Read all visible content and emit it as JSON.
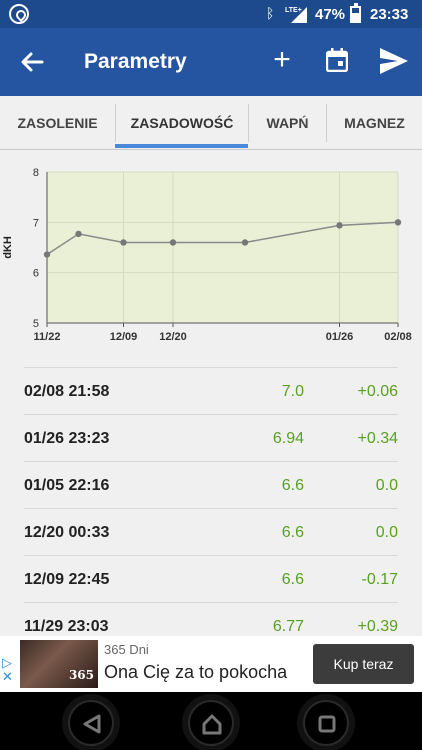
{
  "status_bar": {
    "battery": "47%",
    "time": "23:33",
    "network": "LTE+",
    "icons": [
      "app-notification-icon",
      "bluetooth-icon",
      "signal-icon",
      "battery-icon"
    ]
  },
  "app_bar": {
    "title": "Parametry",
    "icons": [
      "back-arrow-icon",
      "plus-icon",
      "calendar-icon",
      "send-icon"
    ]
  },
  "tabs": [
    {
      "label": "ZASOLENIE",
      "selected": false
    },
    {
      "label": "ZASADOWOŚĆ",
      "selected": true
    },
    {
      "label": "WAPŃ",
      "selected": false
    },
    {
      "label": "MAGNEZ",
      "selected": false
    }
  ],
  "colors": {
    "status_bar": "#1c4a8c",
    "app_bar": "#2555a0",
    "tab_indicator": "#4a88d9",
    "chart_fill": "#e9f0d6",
    "value_green": "#5aa020",
    "cta": "#3c3c3c"
  },
  "chart_data": {
    "type": "line",
    "ylabel": "dKH",
    "ylim": [
      5,
      8
    ],
    "y_ticks": [
      "5",
      "6",
      "7",
      "8"
    ],
    "x_tick_labels": [
      "11/22",
      "12/09",
      "12/20",
      "01/26",
      "02/08"
    ],
    "points": [
      {
        "date": "11/22",
        "y": 6.36
      },
      {
        "date": "11/29",
        "y": 6.77
      },
      {
        "date": "12/09",
        "y": 6.6
      },
      {
        "date": "12/20",
        "y": 6.6
      },
      {
        "date": "01/05",
        "y": 6.6
      },
      {
        "date": "01/26",
        "y": 6.94
      },
      {
        "date": "02/08",
        "y": 7.0
      }
    ]
  },
  "measurements": [
    {
      "date": "02/08 21:58",
      "value": "7.0",
      "delta": "+0.06"
    },
    {
      "date": "01/26 23:23",
      "value": "6.94",
      "delta": "+0.34"
    },
    {
      "date": "01/05 22:16",
      "value": "6.6",
      "delta": "0.0"
    },
    {
      "date": "12/20 00:33",
      "value": "6.6",
      "delta": "0.0"
    },
    {
      "date": "12/09 22:45",
      "value": "6.6",
      "delta": "-0.17"
    },
    {
      "date": "11/29 23:03",
      "value": "6.77",
      "delta": "+0.39"
    }
  ],
  "ad": {
    "advertiser": "365 Dni",
    "headline": "Ona Cię za to pokocha",
    "cta": "Kup teraz",
    "thumbnail_logo": "365"
  },
  "nav_bar": {
    "icons": [
      "back-triangle-icon",
      "home-icon",
      "recents-square-icon"
    ]
  }
}
